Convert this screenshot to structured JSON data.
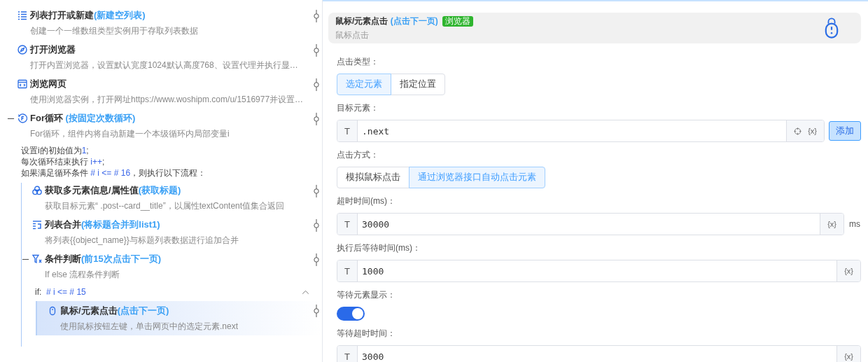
{
  "flow": {
    "steps": [
      {
        "kind": "list",
        "title": "列表打开或新建",
        "note": "(新建空列表)",
        "desc": "创建一个一维数组类型实例用于存取列表数据",
        "selected": false
      },
      {
        "kind": "browser",
        "title": "打开浏览器",
        "desc": "打开内置浏览器，设置默认宽度1024默认高度768、设置代理并执行显…",
        "selected": false
      },
      {
        "kind": "webpage",
        "title": "浏览网页",
        "desc": "使用浏览器实例，打开网址https://www.woshipm.com/u/1516977并设置…",
        "selected": false
      },
      {
        "kind": "loop",
        "title": "For循环",
        "note": " (按固定次数循环)",
        "desc": "For循环，组件内将自动新建一个本级循环内局部变量i",
        "selected": false,
        "expanded": true,
        "loop_lines": [
          {
            "text": "设置i的初始值为",
            "code": "1",
            "end": ";"
          },
          {
            "text": "每次循环结束执行 ",
            "code": "i++",
            "end": ";"
          },
          {
            "text": "如果满足循环条件 ",
            "code": "# i <= # 16",
            "end": "，则执行以下流程："
          }
        ],
        "children": [
          {
            "kind": "multi",
            "title": "获取多元素信息/属性值",
            "note": "(获取标题)",
            "desc": "获取目标元素“ .post--card__title”，以属性textContent值集合返回",
            "selected": false
          },
          {
            "kind": "merge",
            "title": "列表合并",
            "note": "(将标题合并到list1)",
            "desc": "将列表{{object_name}}与标题列表数据进行追加合并",
            "selected": false
          },
          {
            "kind": "condition",
            "title": "条件判断",
            "note": "(前15次点击下一页)",
            "desc": "If else 流程条件判断",
            "selected": false,
            "expanded": true,
            "branch": {
              "label": "if:",
              "condition": "# i <= # 15",
              "expanded": true,
              "children": [
                {
                  "kind": "click",
                  "title": "鼠标/元素点击",
                  "note": "(点击下一页)",
                  "desc": "使用鼠标按钮左键，单击网页中的选定元素.next",
                  "selected": true
                }
              ]
            }
          }
        ]
      }
    ]
  },
  "panel": {
    "header": {
      "title": "鼠标/元素点击",
      "note": "(点击下一页)",
      "badge": "浏览器",
      "subtitle": "鼠标点击"
    },
    "fields": [
      {
        "kind": "choice",
        "label": "点击类型：",
        "options": [
          {
            "label": "选定元素",
            "selected": true
          },
          {
            "label": "指定位置",
            "selected": false
          }
        ]
      },
      {
        "kind": "text",
        "label": "目标元素：",
        "type_tag": "T",
        "value": ".next",
        "picker": true,
        "var_tag": "{x}",
        "button": "添加"
      },
      {
        "kind": "choice",
        "label": "点击方式：",
        "options": [
          {
            "label": "模拟鼠标点击",
            "selected": false
          },
          {
            "label": "通过浏览器接口自动点击元素",
            "selected": true
          }
        ]
      },
      {
        "kind": "text",
        "label": "超时时间(ms)：",
        "type_tag": "T",
        "value": "30000",
        "var_tag": "{x}",
        "unit": "ms"
      },
      {
        "kind": "text",
        "label": "执行后等待时间(ms)：",
        "type_tag": "T",
        "value": "1000",
        "var_tag": "{x}"
      },
      {
        "kind": "switch",
        "label": "等待元素显示：",
        "on": true
      },
      {
        "kind": "text",
        "label": "等待超时时间：",
        "type_tag": "T",
        "value": "3000",
        "var_tag": "{x}"
      }
    ]
  }
}
